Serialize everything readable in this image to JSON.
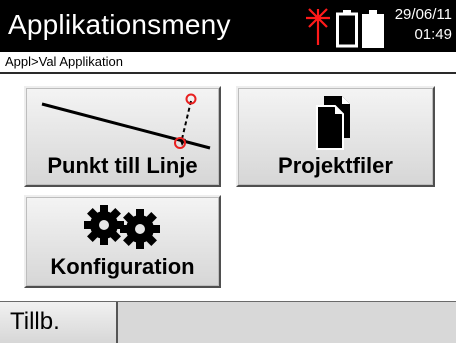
{
  "header": {
    "title": "Applikationsmeny",
    "date": "29/06/11",
    "time": "01:49",
    "icons": [
      "laser-icon",
      "battery-icon",
      "battery-icon"
    ],
    "laser_color": "#ff1a1a"
  },
  "breadcrumb": "Appl>Val Applikation",
  "tiles": [
    {
      "label": "Punkt till Linje",
      "icon": "point-to-line-icon"
    },
    {
      "label": "Projektfiler",
      "icon": "files-icon"
    },
    {
      "label": "Konfiguration",
      "icon": "gears-icon"
    }
  ],
  "footer": {
    "back_label": "Tillb."
  },
  "colors": {
    "header_bg": "#000000",
    "accent_red": "#e82020",
    "tile_bg": "#e4e4e4"
  }
}
